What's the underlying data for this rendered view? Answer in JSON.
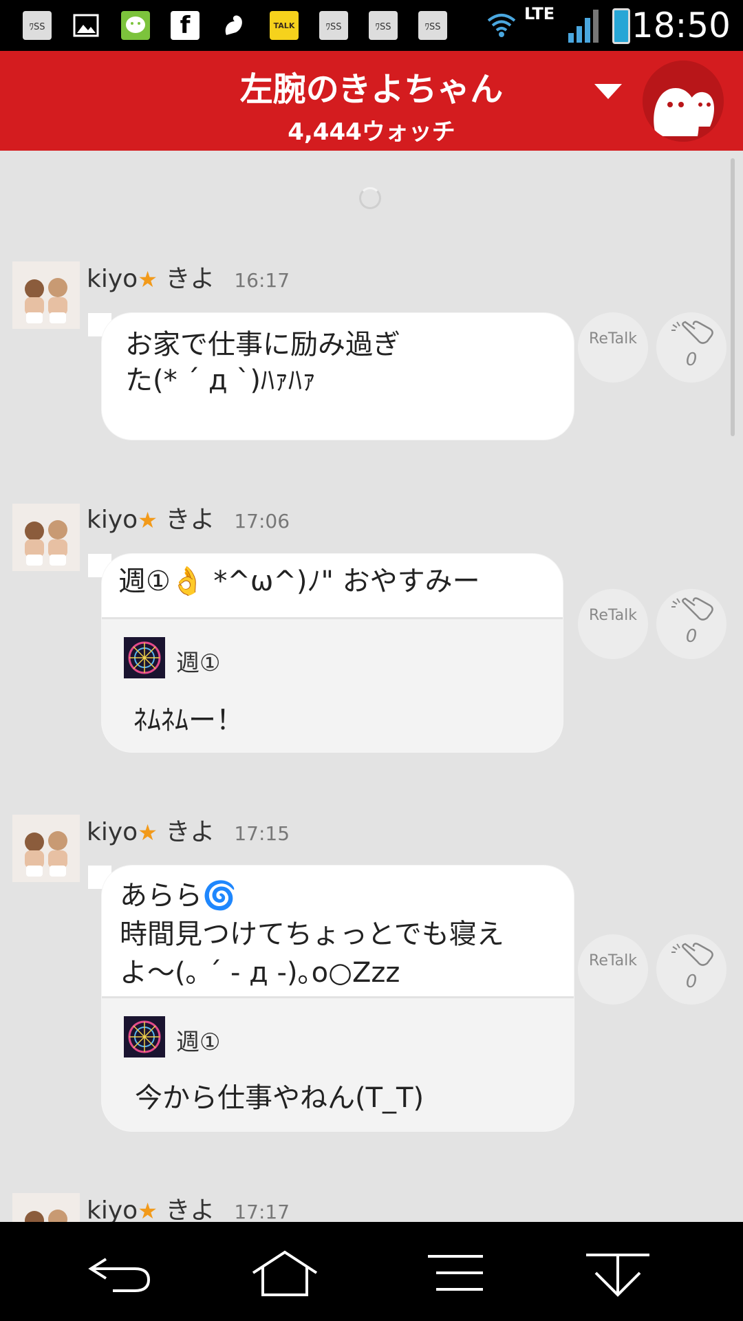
{
  "status_bar": {
    "time": "18:50",
    "network": "LTE",
    "notification_icons": [
      "ﾜSS",
      "picture-icon",
      "line-icon",
      "facebook-icon",
      "squirrel-icon",
      "TALK",
      "ﾜSS",
      "ﾜSS",
      "ﾜSS"
    ]
  },
  "header": {
    "title": "左腕のきよちゃん",
    "subtitle": "4,444ウォッチ",
    "color": "#d41c1f"
  },
  "posts": [
    {
      "user": "kiyo",
      "user_suffix": "きよ",
      "star": "★",
      "time": "16:17",
      "text": "お家で仕事に励み過ぎ\nた(* ´ д `)ﾊｧﾊｧ",
      "retalk": "ReTalk",
      "claps": "0"
    },
    {
      "user": "kiyo",
      "user_suffix": "きよ",
      "star": "★",
      "time": "17:06",
      "text": "週①👌 *^ω^)ﾉ\" おやすみー",
      "quote_name": "週①",
      "quote_text": "ﾈﾑﾈﾑー！",
      "retalk": "ReTalk",
      "claps": "0"
    },
    {
      "user": "kiyo",
      "user_suffix": "きよ",
      "star": "★",
      "time": "17:15",
      "text": "あらら🌀\n時間見つけてちょっとでも寝え\nよ〜(｡ ´ - д -)｡o○Zzz",
      "quote_name": "週①",
      "quote_text": "今から仕事やねん(T_T)",
      "retalk": "ReTalk",
      "claps": "0"
    },
    {
      "user": "kiyo",
      "user_suffix": "きよ",
      "star": "★",
      "time": "17:17"
    }
  ]
}
